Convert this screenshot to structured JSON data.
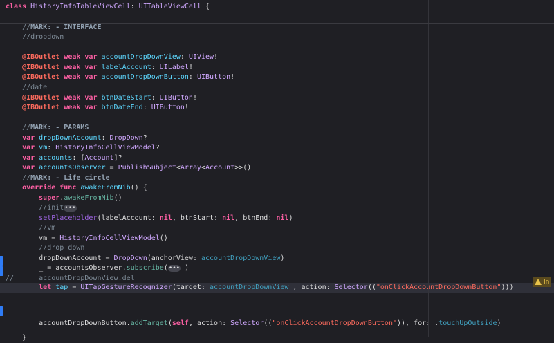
{
  "editor": {
    "lines": [
      [
        [
          "class ",
          "kw"
        ],
        [
          "HistoryInfoTableViewCell",
          "type"
        ],
        [
          ": ",
          "plain"
        ],
        [
          "UITableViewCell",
          "ptype"
        ],
        [
          " {",
          "plain"
        ]
      ],
      [],
      [
        [
          "    //",
          "cmt"
        ],
        [
          "MARK: - INTERFACE",
          "mark"
        ]
      ],
      [
        [
          "    //dropdown",
          "cmt"
        ]
      ],
      [],
      [
        [
          "    @IBOutlet ",
          "attr"
        ],
        [
          "weak var ",
          "kw"
        ],
        [
          "accountDropDownView",
          "decl"
        ],
        [
          ": ",
          "plain"
        ],
        [
          "UIView",
          "ptype"
        ],
        [
          "!",
          "plain"
        ]
      ],
      [
        [
          "    @IBOutlet ",
          "attr"
        ],
        [
          "weak var ",
          "kw"
        ],
        [
          "labelAccount",
          "decl"
        ],
        [
          ": ",
          "plain"
        ],
        [
          "UILabel",
          "ptype"
        ],
        [
          "!",
          "plain"
        ]
      ],
      [
        [
          "    @IBOutlet ",
          "attr"
        ],
        [
          "weak var ",
          "kw"
        ],
        [
          "accountDropDownButton",
          "decl"
        ],
        [
          ": ",
          "plain"
        ],
        [
          "UIButton",
          "ptype"
        ],
        [
          "!",
          "plain"
        ]
      ],
      [
        [
          "    //date",
          "cmt"
        ]
      ],
      [
        [
          "    @IBOutlet ",
          "attr"
        ],
        [
          "weak var ",
          "kw"
        ],
        [
          "btnDateStart",
          "decl"
        ],
        [
          ": ",
          "plain"
        ],
        [
          "UIButton",
          "ptype"
        ],
        [
          "!",
          "plain"
        ]
      ],
      [
        [
          "    @IBOutlet ",
          "attr"
        ],
        [
          "weak var ",
          "kw"
        ],
        [
          "btnDateEnd",
          "decl"
        ],
        [
          ": ",
          "plain"
        ],
        [
          "UIButton",
          "ptype"
        ],
        [
          "!",
          "plain"
        ]
      ],
      [],
      [
        [
          "    //",
          "cmt"
        ],
        [
          "MARK: - PARAMS",
          "mark"
        ]
      ],
      [
        [
          "    var ",
          "kw"
        ],
        [
          "dropDownAccount",
          "decl"
        ],
        [
          ": ",
          "plain"
        ],
        [
          "DropDown",
          "type"
        ],
        [
          "?",
          "plain"
        ]
      ],
      [
        [
          "    var ",
          "kw"
        ],
        [
          "vm",
          "decl"
        ],
        [
          ": ",
          "plain"
        ],
        [
          "HistoryInfoCellViewModel",
          "type"
        ],
        [
          "?",
          "plain"
        ]
      ],
      [
        [
          "    var ",
          "kw"
        ],
        [
          "accounts",
          "decl"
        ],
        [
          ": [",
          "plain"
        ],
        [
          "Account",
          "type"
        ],
        [
          "]?",
          "plain"
        ]
      ],
      [
        [
          "    var ",
          "kw"
        ],
        [
          "accountsObserver",
          "decl"
        ],
        [
          " = ",
          "plain"
        ],
        [
          "PublishSubject",
          "ptype"
        ],
        [
          "<",
          "plain"
        ],
        [
          "Array",
          "ptype"
        ],
        [
          "<",
          "plain"
        ],
        [
          "Account",
          "type"
        ],
        [
          ">>()",
          "plain"
        ]
      ],
      [
        [
          "    //",
          "cmt"
        ],
        [
          "MARK: - Life circle",
          "mark"
        ]
      ],
      [
        [
          "    override func ",
          "kw"
        ],
        [
          "awakeFromNib",
          "decl"
        ],
        [
          "() {",
          "plain"
        ]
      ],
      [
        [
          "        super",
          "kw"
        ],
        [
          ".",
          "plain"
        ],
        [
          "awakeFromNib",
          "fn"
        ],
        [
          "()",
          "plain"
        ]
      ],
      [
        [
          "        //init",
          "cmt"
        ],
        [
          "•••",
          "fold"
        ]
      ],
      [
        [
          "        ",
          "plain"
        ],
        [
          "setPlaceholder",
          "ufn"
        ],
        [
          "(labelAccount: ",
          "plain"
        ],
        [
          "nil",
          "kw"
        ],
        [
          ", btnStart: ",
          "plain"
        ],
        [
          "nil",
          "kw"
        ],
        [
          ", btnEnd: ",
          "plain"
        ],
        [
          "nil",
          "kw"
        ],
        [
          ")",
          "plain"
        ]
      ],
      [
        [
          "        //vm",
          "cmt"
        ]
      ],
      [
        [
          "        vm = ",
          "plain"
        ],
        [
          "HistoryInfoCellViewModel",
          "type"
        ],
        [
          "()",
          "plain"
        ]
      ],
      [
        [
          "        //drop down",
          "cmt"
        ]
      ],
      [
        [
          "        dropDownAccount = ",
          "plain"
        ],
        [
          "DropDown",
          "type"
        ],
        [
          "(anchorView: ",
          "plain"
        ],
        [
          "accountDropDownView",
          "prop"
        ],
        [
          ")",
          "plain"
        ]
      ],
      [
        [
          "        _ = accountsObserver.",
          "plain"
        ],
        [
          "subscribe",
          "fn"
        ],
        [
          "(",
          "plain"
        ],
        [
          "•••",
          "fold"
        ],
        [
          " )",
          "plain"
        ]
      ],
      [
        [
          "//      accountDropDownView.del",
          "cmt"
        ]
      ],
      [
        [
          "        let ",
          "kw"
        ],
        [
          "tap",
          "decl"
        ],
        [
          " = ",
          "plain"
        ],
        [
          "UITapGestureRecognizer",
          "ptype"
        ],
        [
          "(target: ",
          "plain"
        ],
        [
          "accountDropDownView",
          "prop"
        ],
        [
          " , action: ",
          "plain"
        ],
        [
          "Selector",
          "ptype"
        ],
        [
          "((",
          "plain"
        ],
        [
          "\"onClickAccountDropDownButton\"",
          "str"
        ],
        [
          ")))",
          "plain"
        ]
      ],
      [],
      [],
      [
        [
          "        accountDropDownButton.",
          "plain"
        ],
        [
          "addTarget",
          "fn"
        ],
        [
          "(",
          "plain"
        ],
        [
          "self",
          "kw"
        ],
        [
          ", action: ",
          "plain"
        ],
        [
          "Selector",
          "ptype"
        ],
        [
          "((",
          "plain"
        ],
        [
          "\"onClickAccountDropDownButton\"",
          "str"
        ],
        [
          ")), for: .",
          "plain"
        ],
        [
          "touchUpOutside",
          "prop"
        ],
        [
          ")",
          "plain"
        ]
      ],
      [],
      [
        [
          "    }",
          "plain"
        ]
      ]
    ],
    "warning": {
      "label": "In"
    },
    "colors": {
      "background": "#1f1f24",
      "current_line": "#2f3039",
      "breakpoint": "#2f7cf6",
      "warning": "#e8c34a"
    }
  }
}
